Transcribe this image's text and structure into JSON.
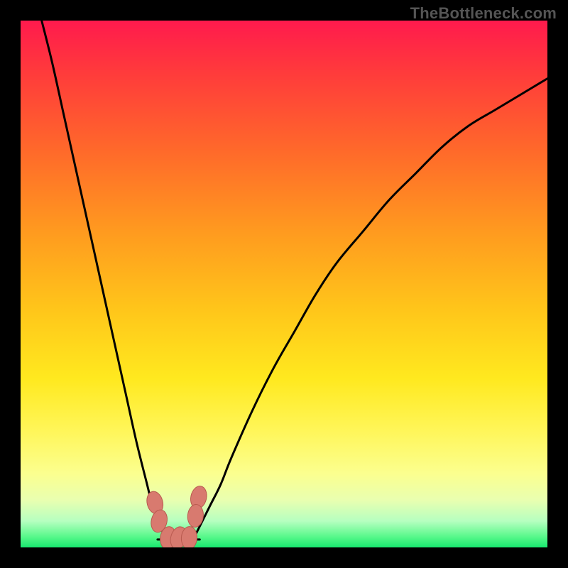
{
  "watermark": "TheBottleneck.com",
  "chart_data": {
    "type": "line",
    "title": "",
    "xlabel": "",
    "ylabel": "",
    "xlim": [
      0,
      100
    ],
    "ylim": [
      0,
      100
    ],
    "series": [
      {
        "name": "left-curve",
        "x": [
          4,
          6,
          8,
          10,
          12,
          14,
          16,
          18,
          20,
          22,
          24,
          25,
          26,
          27,
          28
        ],
        "values": [
          100,
          92,
          83,
          74,
          65,
          56,
          47,
          38,
          29,
          20,
          12,
          8,
          5,
          3,
          2
        ]
      },
      {
        "name": "right-curve",
        "x": [
          33,
          34,
          36,
          38,
          40,
          44,
          48,
          52,
          56,
          60,
          65,
          70,
          75,
          80,
          85,
          90,
          95,
          100
        ],
        "values": [
          2,
          4,
          8,
          12,
          17,
          26,
          34,
          41,
          48,
          54,
          60,
          66,
          71,
          76,
          80,
          83,
          86,
          89
        ]
      },
      {
        "name": "bottom-baseline",
        "x": [
          26,
          34
        ],
        "values": [
          1.5,
          1.5
        ]
      }
    ],
    "markers": [
      {
        "name": "cluster-left-upper",
        "x": 25.5,
        "y": 8.5
      },
      {
        "name": "cluster-left-lower",
        "x": 26.3,
        "y": 5.0
      },
      {
        "name": "cluster-right-upper",
        "x": 33.8,
        "y": 9.5
      },
      {
        "name": "cluster-right-lower",
        "x": 33.2,
        "y": 6.0
      },
      {
        "name": "bottom-left",
        "x": 28.0,
        "y": 1.8
      },
      {
        "name": "bottom-mid",
        "x": 30.0,
        "y": 1.8
      },
      {
        "name": "bottom-right",
        "x": 32.0,
        "y": 1.8
      }
    ],
    "colors": {
      "curve": "#000000",
      "marker_fill": "#d87a6f",
      "marker_stroke": "#b85a4f"
    }
  }
}
